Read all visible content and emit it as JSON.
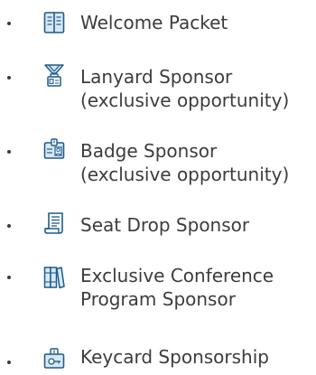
{
  "colors": {
    "text": "#3c3c3c",
    "icon_stroke": "#1f5c8a",
    "icon_fill": "#d8e8f4"
  },
  "items": [
    {
      "icon": "book-icon",
      "lines": [
        "Welcome Packet"
      ]
    },
    {
      "icon": "lanyard-icon",
      "lines": [
        "Lanyard Sponsor",
        "(exclusive opportunity)"
      ]
    },
    {
      "icon": "badge-icon",
      "lines": [
        "Badge Sponsor",
        "(exclusive opportunity)"
      ]
    },
    {
      "icon": "document-icon",
      "lines": [
        "Seat Drop Sponsor"
      ]
    },
    {
      "icon": "binders-icon",
      "lines": [
        "Exclusive Conference",
        "Program Sponsor"
      ]
    },
    {
      "icon": "keycard-icon",
      "lines": [
        "Keycard Sponsorship"
      ]
    }
  ]
}
